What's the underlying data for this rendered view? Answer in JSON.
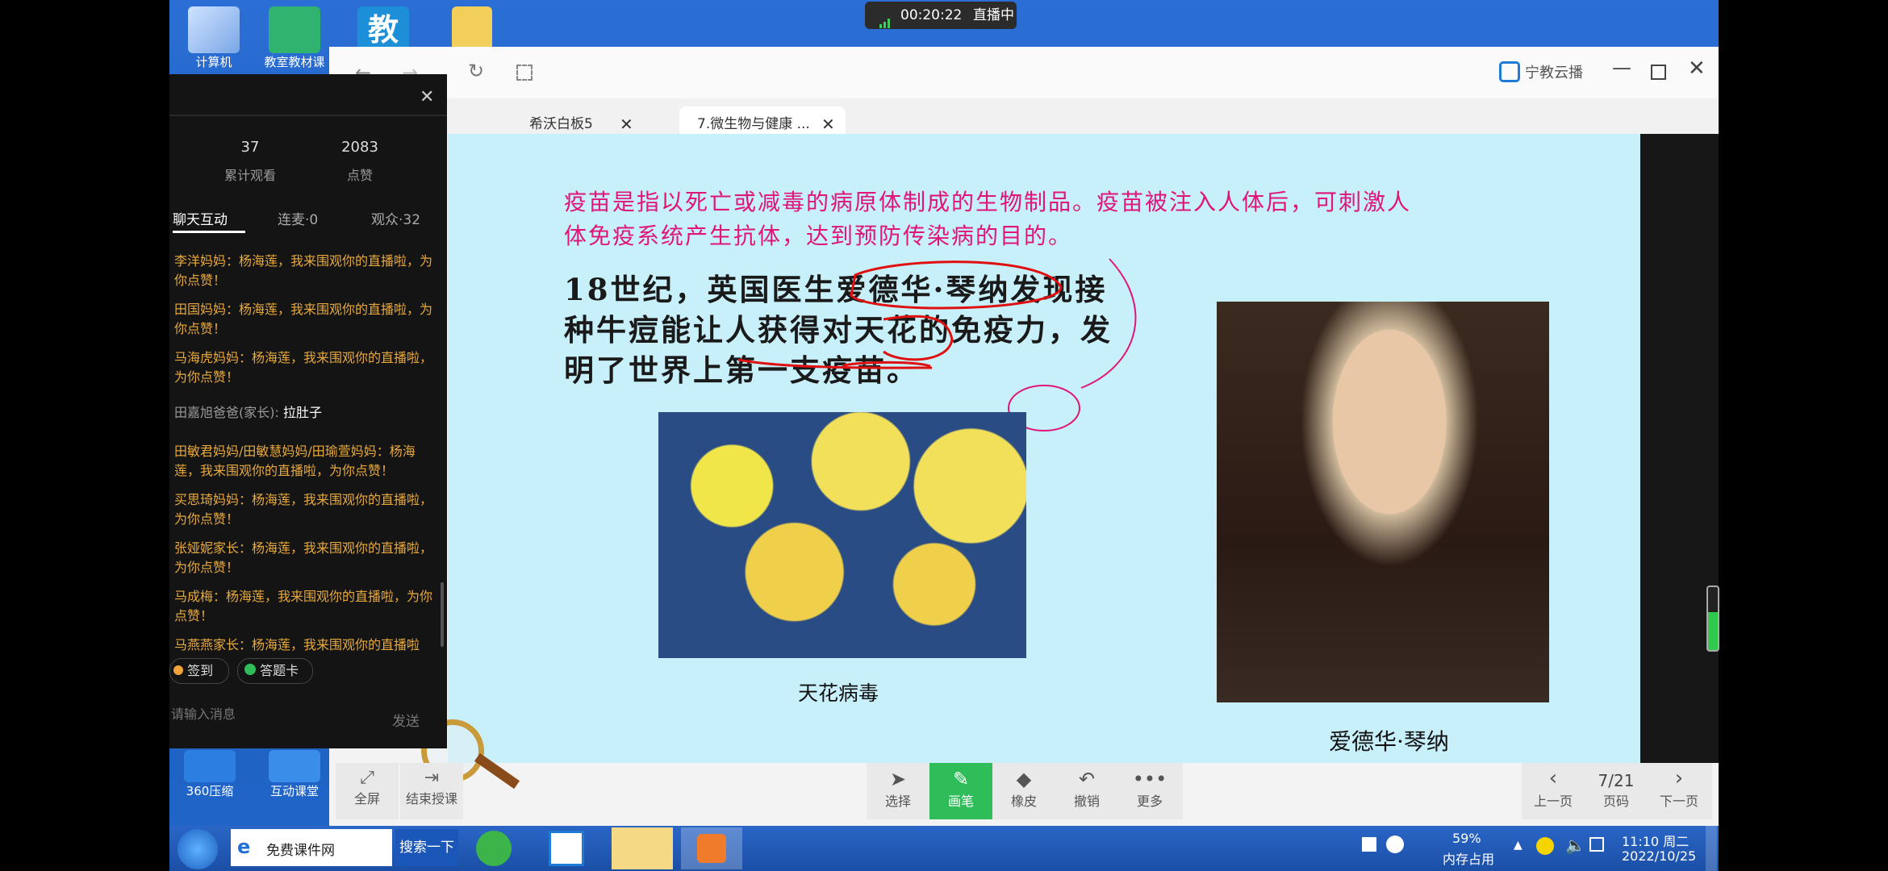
{
  "desktop": {
    "icons": [
      {
        "label": "计算机"
      },
      {
        "label": "教室教材课"
      },
      {
        "label": "教"
      },
      {
        "label": ""
      }
    ],
    "bottom_icons": [
      {
        "label": "360压缩"
      },
      {
        "label": "互动课堂"
      }
    ]
  },
  "live": {
    "timer": "00:20:22",
    "status": "直播中"
  },
  "browser": {
    "brand": "宁教云播",
    "tabs": [
      {
        "label": "希沃白板5"
      },
      {
        "label": "7.微生物与健康 ..."
      }
    ]
  },
  "panel": {
    "views": "37",
    "views_label": "累计观看",
    "likes": "2083",
    "likes_label": "点赞",
    "tabs": [
      "聊天互动",
      "连麦·0",
      "观众·32"
    ],
    "messages": [
      {
        "text": "李洋妈妈：杨海莲，我来围观你的直播啦，为你点赞！",
        "color": "#e7a93c"
      },
      {
        "text": "田国妈妈：杨海莲，我来围观你的直播啦，为你点赞！",
        "color": "#e7a93c"
      },
      {
        "text": "马海虎妈妈：杨海莲，我来围观你的直播啦，为你点赞！",
        "color": "#e7a93c"
      },
      {
        "text": "田嘉旭爸爸(家长): ",
        "extra": "拉肚子",
        "color": "#9a9a9a"
      },
      {
        "text": "田敏君妈妈/田敏慧妈妈/田瑜萱妈妈：杨海莲，我来围观你的直播啦，为你点赞！",
        "color": "#e7a93c"
      },
      {
        "text": "买思琦妈妈：杨海莲，我来围观你的直播啦，为你点赞！",
        "color": "#e7a93c"
      },
      {
        "text": "张娅妮家长：杨海莲，我来围观你的直播啦，为你点赞！",
        "color": "#e7a93c"
      },
      {
        "text": "马成梅：杨海莲，我来围观你的直播啦，为你点赞！",
        "color": "#e7a93c"
      },
      {
        "text": "马燕燕家长：杨海莲，我来围观你的直播啦",
        "color": "#e7a93c"
      }
    ],
    "signin": "签到",
    "answer_card": "答题卡",
    "input_placeholder": "请输入消息",
    "send": "发送"
  },
  "slide": {
    "definition": "疫苗是指以死亡或减毒的病原体制成的生物制品。疫苗被注入人体后，可刺激人体免疫系统产生抗体，达到预防传染病的目的。",
    "line1": "18世纪，英国医生爱德华·琴纳发现接",
    "line2": "种牛痘能让人获得对天花的免疫力，发",
    "line3": "明了世界上第一支疫苗。",
    "image1_caption": "天花病毒",
    "image2_caption": "爱德华·琴纳"
  },
  "controls": {
    "fullscreen": "全屏",
    "end_class": "结束授课",
    "select": "选择",
    "pen": "画笔",
    "eraser": "橡皮",
    "undo": "撤销",
    "more": "更多",
    "prev": "上一页",
    "page": "7/21",
    "page_label": "页码",
    "next": "下一页"
  },
  "taskbar": {
    "browser_label": "免费课件网",
    "search_btn": "搜索一下",
    "memory_pct": "59%",
    "memory_label": "内存占用",
    "time": "11:10 周二",
    "date": "2022/10/25"
  },
  "colors": {
    "pen_active": "#2ebd59",
    "slide_bg": "#c8f0fa",
    "definition_text": "#e0157a",
    "chat_text": "#e7a93c"
  }
}
